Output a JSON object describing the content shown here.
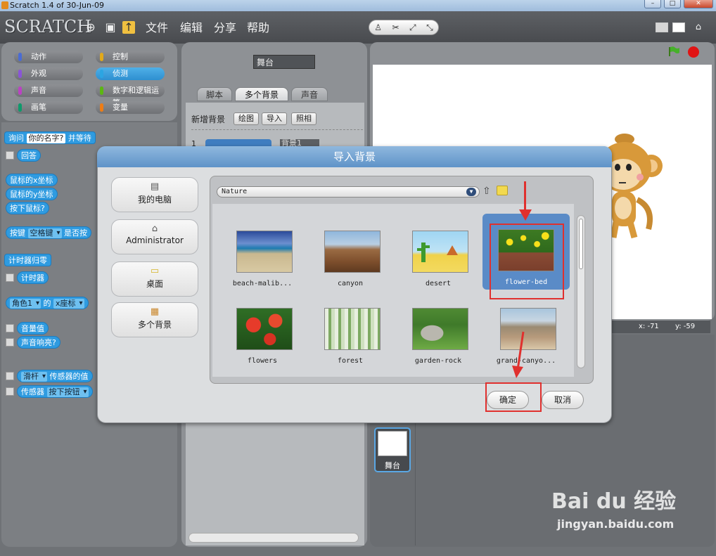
{
  "window": {
    "title": "Scratch 1.4 of 30-Jun-09"
  },
  "toolbar": {
    "logo": "SCRATCH",
    "menus": [
      "文件",
      "编辑",
      "分享",
      "帮助"
    ],
    "icons": [
      "globe-icon",
      "save-icon",
      "share-icon"
    ],
    "mode_icons": [
      "♙",
      "✂",
      "⤢",
      "⤡"
    ]
  },
  "categories": [
    {
      "label": "动作",
      "color": "#4a6cd4"
    },
    {
      "label": "控制",
      "color": "#e1a91a"
    },
    {
      "label": "外观",
      "color": "#8a55d7"
    },
    {
      "label": "侦测",
      "color": "#2ca5e2"
    },
    {
      "label": "声音",
      "color": "#bb42c3"
    },
    {
      "label": "数字和逻辑运算",
      "color": "#5cb712"
    },
    {
      "label": "画笔",
      "color": "#0e9a6c"
    },
    {
      "label": "变量",
      "color": "#ee7d16"
    }
  ],
  "blocks": {
    "ask": {
      "pre": "询问",
      "slot": "你的名字?",
      "post": "并等待"
    },
    "answer": "回答",
    "mouse_x": "鼠标的x坐标",
    "mouse_y": "鼠标的y坐标",
    "mouse_down": "按下鼠标?",
    "key": {
      "pre": "按键",
      "dd": "空格键",
      "post": "是否按"
    },
    "reset_timer": "计时器归零",
    "timer": "计时器",
    "of": {
      "dd1": "角色1",
      "mid": "的",
      "dd2": "x座标"
    },
    "loudness": "音量值",
    "loud": "声音响亮?",
    "sensor_value": {
      "dd": "滑杆",
      "post": "传感器的值"
    },
    "sensor": {
      "pre": "传感器",
      "dd": "按下按钮"
    }
  },
  "middle": {
    "sprite_name": "舞台",
    "tabs": [
      "脚本",
      "多个背景",
      "声音"
    ],
    "new_bg_label": "新增背景",
    "new_bg_buttons": [
      "绘图",
      "导入",
      "照相"
    ],
    "list_index": "1",
    "list_name_partial": "背景1"
  },
  "stage": {
    "coords_x": "x: -71",
    "coords_y": "y: -59",
    "thumb_label": "舞台"
  },
  "dialog": {
    "title": "导入背景",
    "locations": [
      {
        "label": "我的电脑",
        "icon": "computer-icon"
      },
      {
        "label": "Administrator",
        "icon": "home-icon"
      },
      {
        "label": "桌面",
        "icon": "folder-icon"
      },
      {
        "label": "多个背景",
        "icon": "backgrounds-folder-icon"
      }
    ],
    "path": "Nature",
    "items": [
      {
        "name": "beach-malib...",
        "selected": false
      },
      {
        "name": "canyon",
        "selected": false
      },
      {
        "name": "desert",
        "selected": false
      },
      {
        "name": "flower-bed",
        "selected": true
      },
      {
        "name": "flowers",
        "selected": false
      },
      {
        "name": "forest",
        "selected": false
      },
      {
        "name": "garden-rock",
        "selected": false
      },
      {
        "name": "grand-canyo...",
        "selected": false
      }
    ],
    "ok_label": "确定",
    "cancel_label": "取消"
  },
  "watermark": {
    "brand": "Bai du 经验",
    "url": "jingyan.baidu.com"
  },
  "colors": {
    "accent": "#2f9be0",
    "selection": "#5a8bc7",
    "highlight": "#e0302e"
  }
}
